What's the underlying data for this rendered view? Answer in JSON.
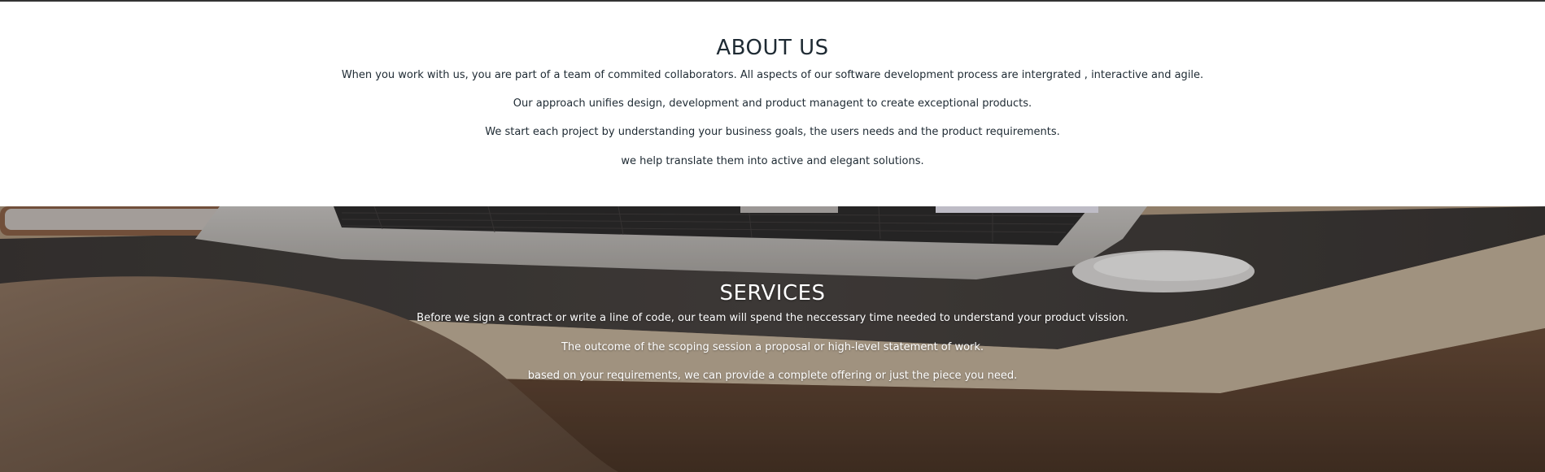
{
  "about": {
    "title": "ABOUT US",
    "paragraphs": [
      "When you work with us, you are part of a team of commited collaborators. All aspects of our software development process are intergrated , interactive and agile.",
      "Our approach unifies design, development and product managent to create exceptional products.",
      "We start each project by understanding your business goals, the users needs and the product requirements.",
      "we help translate them into active and elegant solutions."
    ]
  },
  "services": {
    "title": "SERVICES",
    "paragraphs": [
      "Before we sign a contract or write a line of code, our team will spend the neccessary time needed to understand your product vission.",
      "The outcome of the scoping session a proposal or high-level statement of work.",
      "based on your requirements, we can provide a complete offering or just the piece you need."
    ],
    "background_image": "laptop-on-desk-photo"
  },
  "colors": {
    "about_text": "#1e2a33",
    "services_text": "#ffffff",
    "top_border": "#333333"
  }
}
